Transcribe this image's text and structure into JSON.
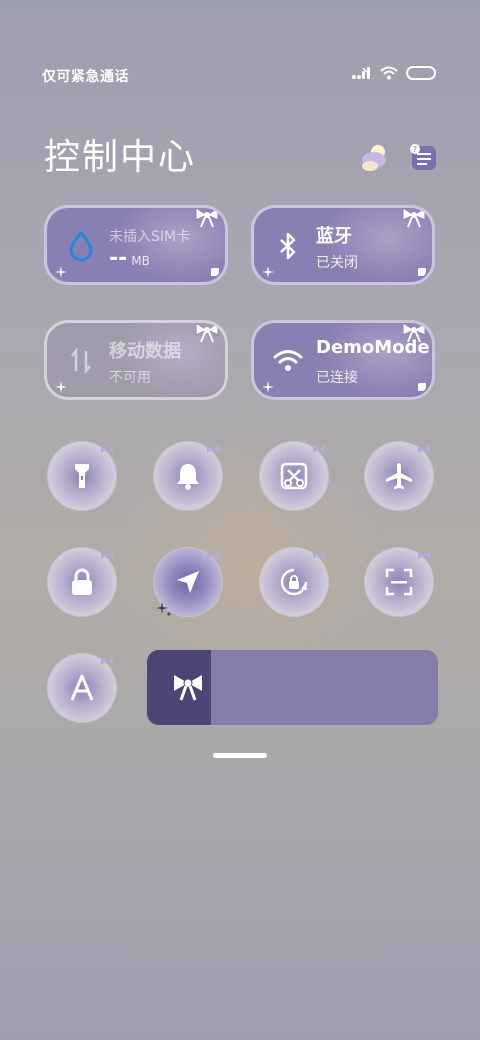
{
  "status_bar": {
    "carrier": "仅可紧急通话"
  },
  "title": "控制中心",
  "tiles": {
    "data": {
      "label": "未插入SIM卡",
      "value": "--",
      "unit": "MB",
      "icon": "water-drop-icon"
    },
    "bluetooth": {
      "label": "蓝牙",
      "status": "已关闭",
      "icon": "bluetooth-icon"
    },
    "mobile_data": {
      "label": "移动数据",
      "status": "不可用",
      "icon": "data-arrows-icon"
    },
    "wifi": {
      "label": "DemoMode",
      "status": "已连接",
      "icon": "wifi-icon"
    }
  },
  "toggles": [
    {
      "name": "flashlight",
      "icon": "flashlight-icon"
    },
    {
      "name": "bell",
      "icon": "bell-icon"
    },
    {
      "name": "screenshot",
      "icon": "scissors-icon"
    },
    {
      "name": "airplane",
      "icon": "airplane-icon"
    },
    {
      "name": "lock",
      "icon": "lock-icon"
    },
    {
      "name": "location",
      "icon": "location-arrow-icon"
    },
    {
      "name": "rotation-lock",
      "icon": "rotation-lock-icon"
    },
    {
      "name": "scanner",
      "icon": "scan-icon"
    },
    {
      "name": "font",
      "icon": "font-a-icon"
    }
  ],
  "brightness": {
    "level": 0.22,
    "icon": "bow-icon"
  },
  "colors": {
    "tile_on": "#8a7fb2",
    "slider_bg": "#857ca9",
    "slider_fill": "#4c4474",
    "data_icon": "#1e88e5"
  }
}
